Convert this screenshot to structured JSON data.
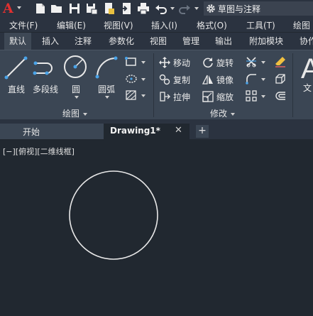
{
  "app": {
    "logo_letter": "A",
    "workspace": "草图与注释"
  },
  "menu": [
    "文件(F)",
    "编辑(E)",
    "视图(V)",
    "插入(I)",
    "格式(O)",
    "工具(T)",
    "绘图"
  ],
  "ribbon_tabs": [
    "默认",
    "插入",
    "注释",
    "参数化",
    "视图",
    "管理",
    "输出",
    "附加模块",
    "协作"
  ],
  "active_ribbon_tab": "默认",
  "draw_panel": {
    "title": "绘图",
    "tools": [
      "直线",
      "多段线",
      "圆",
      "圆弧"
    ]
  },
  "modify_panel": {
    "title": "修改",
    "tools": [
      "移动",
      "旋转",
      "复制",
      "镜像",
      "拉伸",
      "缩放"
    ]
  },
  "text_panel": {
    "big_letter": "A",
    "label": "文"
  },
  "file_tabs": {
    "start": "开始",
    "document": "Drawing1*",
    "close": "✕",
    "add": "+"
  },
  "canvas": {
    "viewport_label": "[−][俯视][二维线框]"
  },
  "colors": {
    "canvas_bg": "#212830",
    "ribbon_bg": "#3b4654",
    "toolbar_bg": "#2b3340",
    "accent_blue": "#4aa3e8",
    "logo_red": "#e03030",
    "circle_stroke": "#e8e8e8"
  }
}
